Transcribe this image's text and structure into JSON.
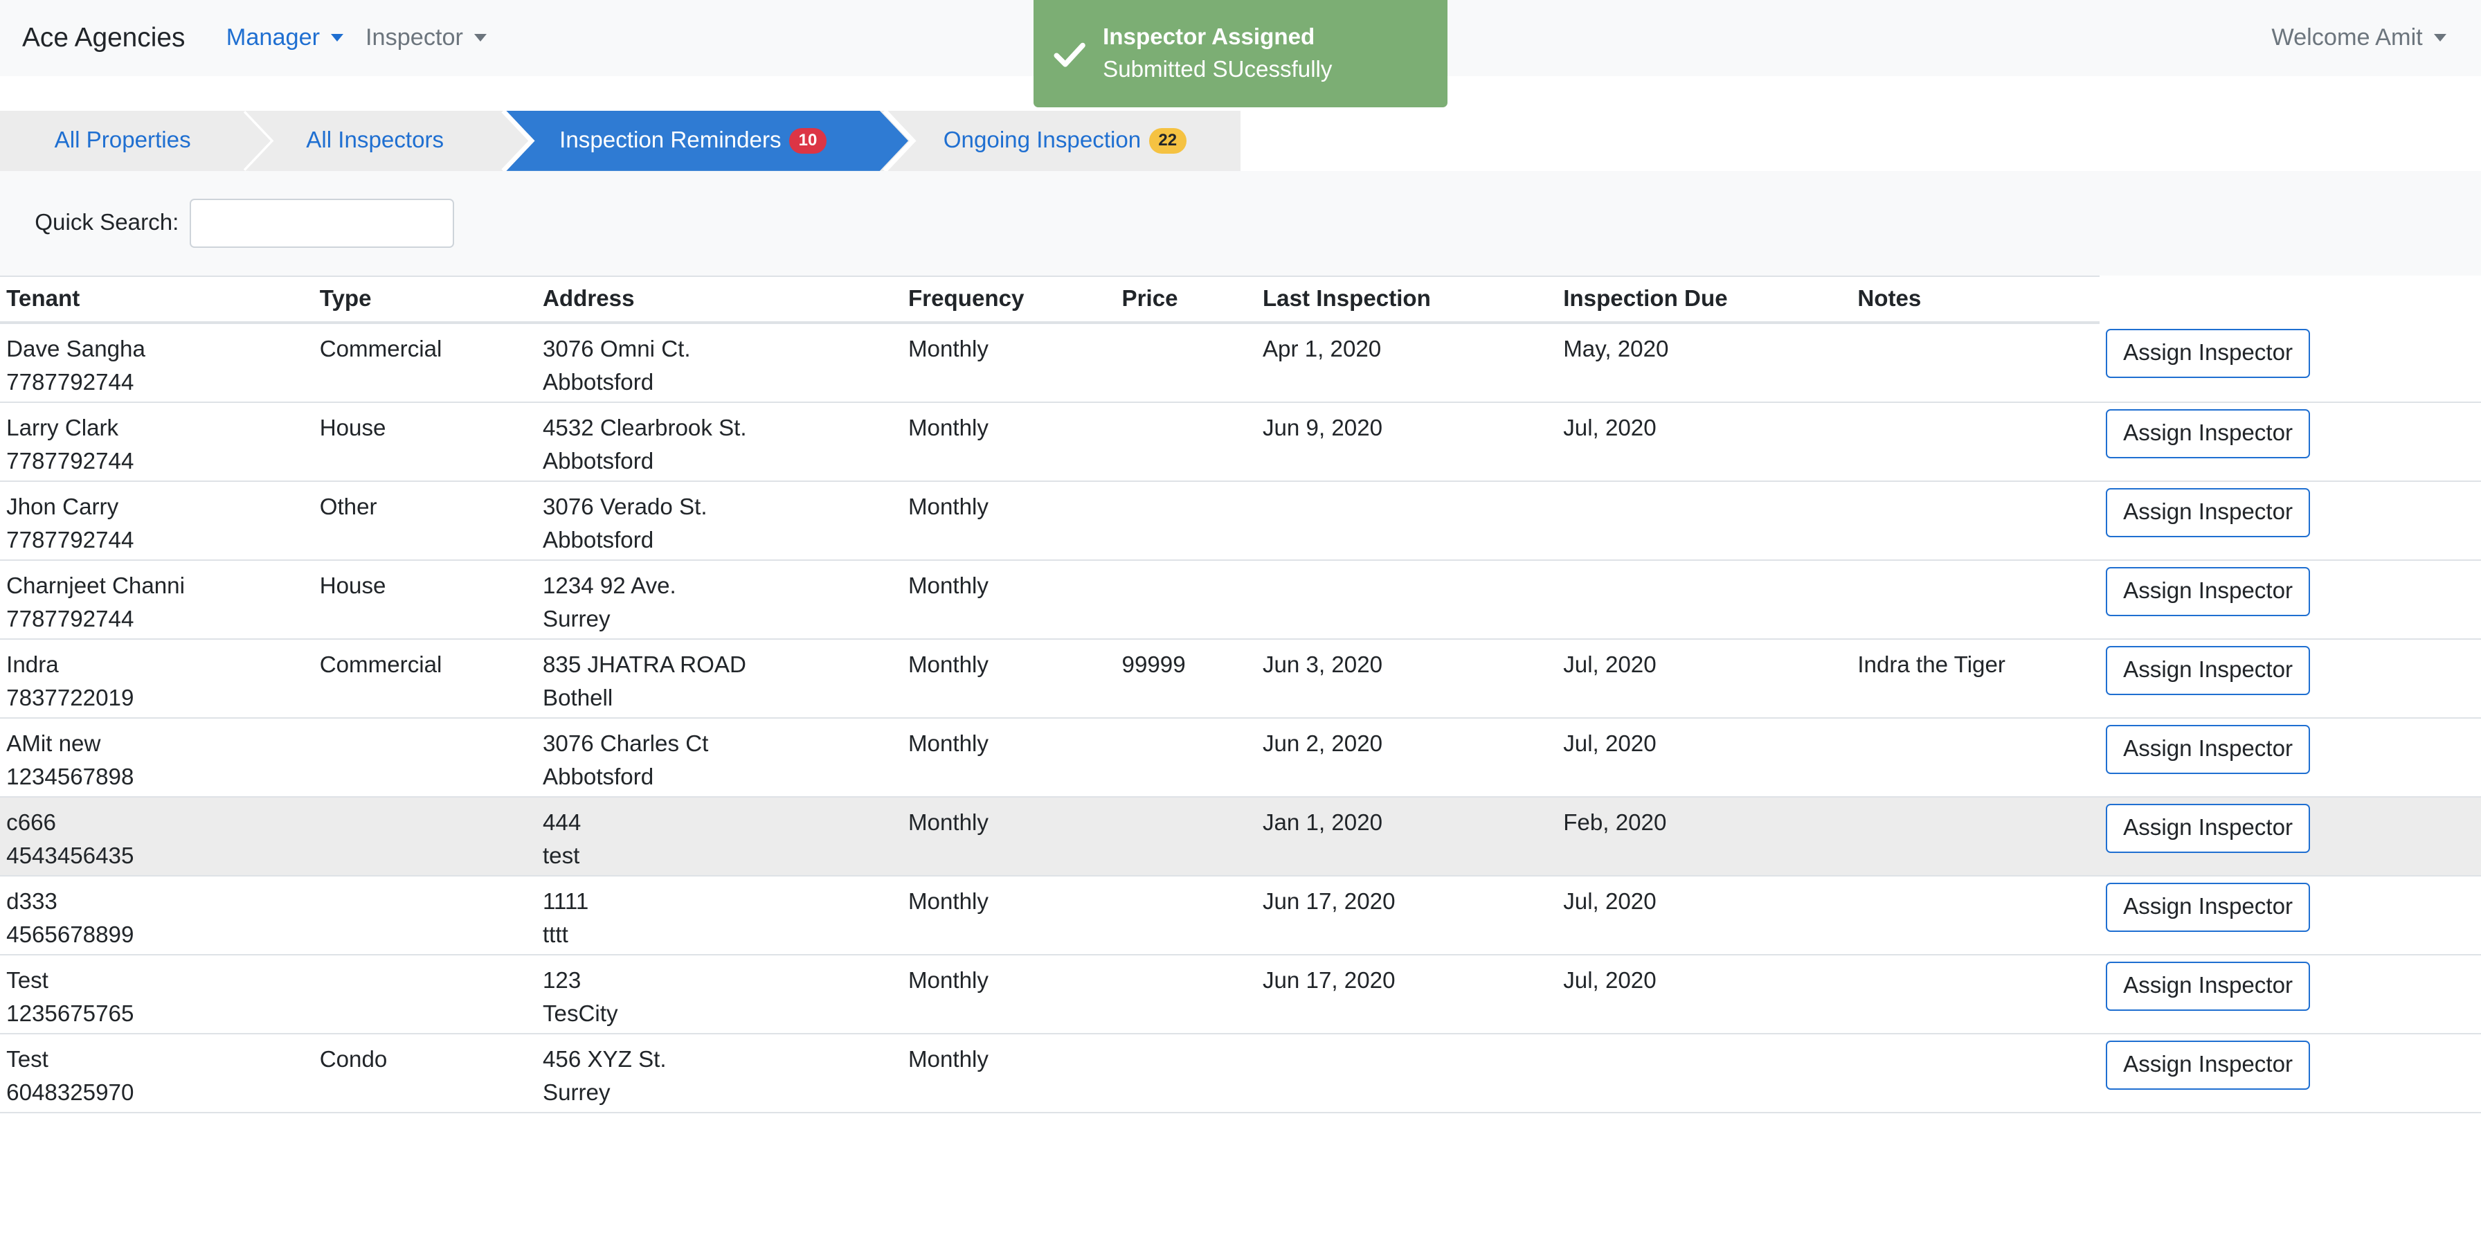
{
  "navbar": {
    "brand": "Ace Agencies",
    "manager_label": "Manager",
    "inspector_label": "Inspector",
    "welcome": "Welcome Amit"
  },
  "toast": {
    "title": "Inspector Assigned",
    "message": "Submitted SUcessfully",
    "icon": "check-icon",
    "color": "#7cae74"
  },
  "tabs": [
    {
      "label": "All Properties",
      "badge": ""
    },
    {
      "label": "All Inspectors",
      "badge": ""
    },
    {
      "label": "Inspection Reminders",
      "badge": "10"
    },
    {
      "label": "Ongoing Inspection",
      "badge": "22"
    }
  ],
  "search": {
    "label": "Quick Search:",
    "value": ""
  },
  "table": {
    "headers": [
      "Tenant",
      "Type",
      "Address",
      "Frequency",
      "Price",
      "Last Inspection",
      "Inspection Due",
      "Notes"
    ],
    "action_label": "Assign Inspector",
    "rows": [
      {
        "tenant": "Dave Sangha",
        "phone": "7787792744",
        "type": "Commercial",
        "street": "3076 Omni Ct.",
        "city": "Abbotsford",
        "frequency": "Monthly",
        "price": "",
        "last": "Apr 1, 2020",
        "due": "May, 2020",
        "notes": ""
      },
      {
        "tenant": "Larry Clark",
        "phone": "7787792744",
        "type": "House",
        "street": "4532 Clearbrook St.",
        "city": "Abbotsford",
        "frequency": "Monthly",
        "price": "",
        "last": "Jun 9, 2020",
        "due": "Jul, 2020",
        "notes": ""
      },
      {
        "tenant": "Jhon Carry",
        "phone": "7787792744",
        "type": "Other",
        "street": "3076 Verado St.",
        "city": "Abbotsford",
        "frequency": "Monthly",
        "price": "",
        "last": "",
        "due": "",
        "notes": ""
      },
      {
        "tenant": "Charnjeet Channi",
        "phone": "7787792744",
        "type": "House",
        "street": "1234 92 Ave.",
        "city": "Surrey",
        "frequency": "Monthly",
        "price": "",
        "last": "",
        "due": "",
        "notes": ""
      },
      {
        "tenant": "Indra",
        "phone": "7837722019",
        "type": "Commercial",
        "street": "835 JHATRA ROAD",
        "city": "Bothell",
        "frequency": "Monthly",
        "price": "99999",
        "last": "Jun 3, 2020",
        "due": "Jul, 2020",
        "notes": "Indra the Tiger"
      },
      {
        "tenant": "AMit new",
        "phone": "1234567898",
        "type": "",
        "street": "3076 Charles Ct",
        "city": "Abbotsford",
        "frequency": "Monthly",
        "price": "",
        "last": "Jun 2, 2020",
        "due": "Jul, 2020",
        "notes": ""
      },
      {
        "tenant": "c666",
        "phone": "4543456435",
        "type": "",
        "street": "444",
        "city": "test",
        "frequency": "Monthly",
        "price": "",
        "last": "Jan 1, 2020",
        "due": "Feb, 2020",
        "notes": ""
      },
      {
        "tenant": "d333",
        "phone": "4565678899",
        "type": "",
        "street": "1111",
        "city": "tttt",
        "frequency": "Monthly",
        "price": "",
        "last": "Jun 17, 2020",
        "due": "Jul, 2020",
        "notes": ""
      },
      {
        "tenant": "Test",
        "phone": "1235675765",
        "type": "",
        "street": "123",
        "city": "TesCity",
        "frequency": "Monthly",
        "price": "",
        "last": "Jun 17, 2020",
        "due": "Jul, 2020",
        "notes": ""
      },
      {
        "tenant": "Test",
        "phone": "6048325970",
        "type": "Condo",
        "street": "456 XYZ St.",
        "city": "Surrey",
        "frequency": "Monthly",
        "price": "",
        "last": "",
        "due": "",
        "notes": ""
      }
    ]
  },
  "colors": {
    "accent": "#1f6fd1",
    "active_tab": "#2f7bd3",
    "badge_red": "#dc3545",
    "badge_yellow": "#f5c242"
  }
}
